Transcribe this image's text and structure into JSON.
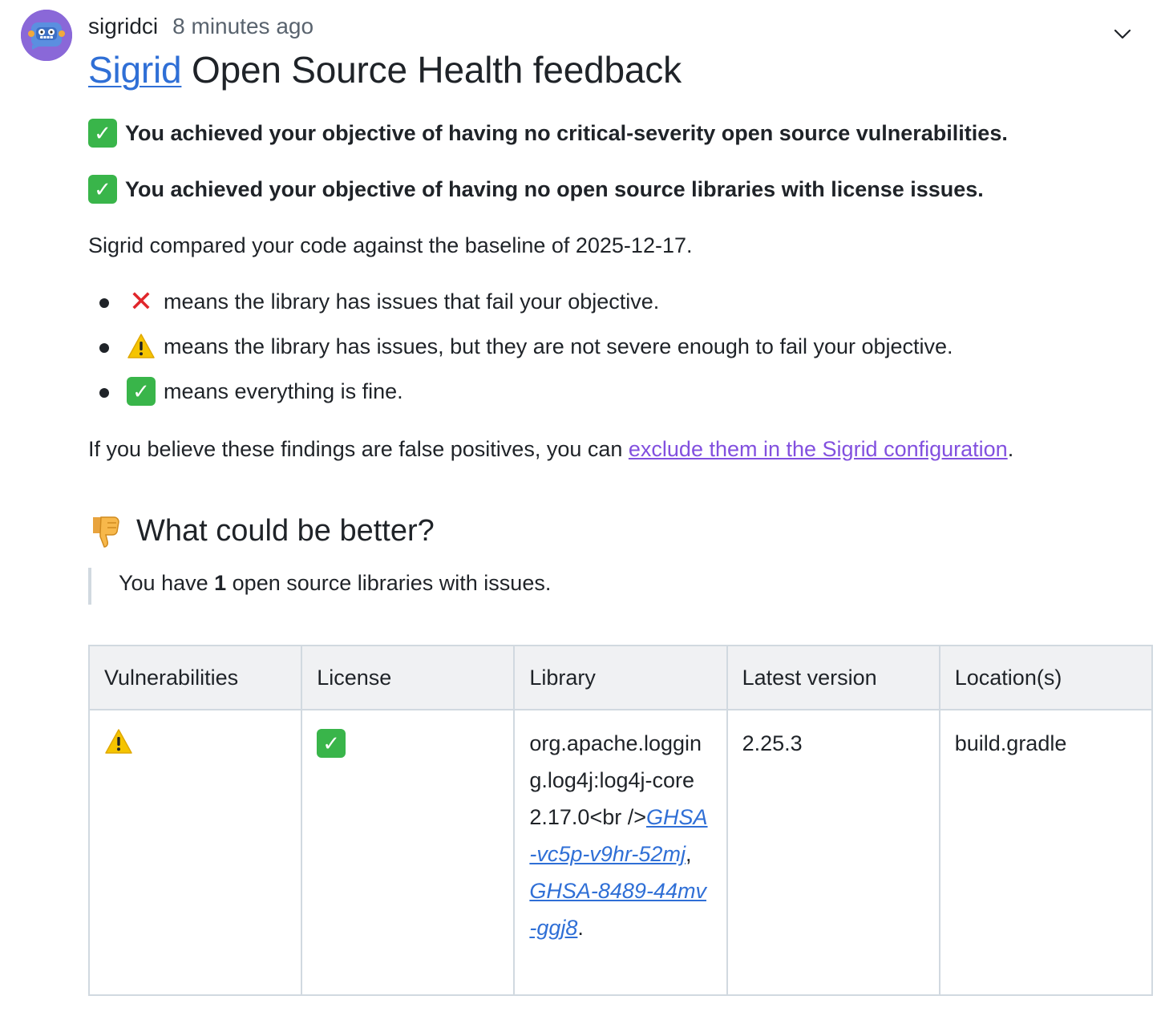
{
  "comment": {
    "author": "sigridci",
    "timestamp": "8 minutes ago",
    "icons": {
      "avatar": "robot-avatar-icon",
      "menu": "chevron-down-icon"
    }
  },
  "title": {
    "link_text": "Sigrid",
    "rest": " Open Source Health feedback"
  },
  "objectives": [
    {
      "icon": "check-mark-icon",
      "text": "You achieved your objective of having no critical-severity open source vulnerabilities."
    },
    {
      "icon": "check-mark-icon",
      "text": "You achieved your objective of having no open source libraries with license issues."
    }
  ],
  "baseline_text": "Sigrid compared your code against the baseline of 2025-12-17.",
  "legend": [
    {
      "icon": "cross-mark-icon",
      "text": "means the library has issues that fail your objective."
    },
    {
      "icon": "warning-icon",
      "text": "means the library has issues, but they are not severe enough to fail your objective."
    },
    {
      "icon": "check-mark-icon",
      "text": "means everything is fine."
    }
  ],
  "false_positive": {
    "before": "If you believe these findings are false positives, you can ",
    "link": "exclude them in the Sigrid configuration",
    "after": "."
  },
  "section_heading": {
    "icon": "thumbs-down-icon",
    "text": "What could be better?"
  },
  "summary": {
    "before": "You have ",
    "count": "1",
    "after": " open source libraries with issues."
  },
  "table": {
    "headers": [
      "Vulnerabilities",
      "License",
      "Library",
      "Latest version",
      "Location(s)"
    ],
    "rows": [
      {
        "vulnerabilities_icon": "warning-icon",
        "license_icon": "check-mark-icon",
        "library_text": "org.apache.logging.log4j:log4j-core 2.17.0<br />",
        "advisory_1": "GHSA-vc5p-v9hr-52mj",
        "separator": ", ",
        "advisory_2": "GHSA-8489-44mv-ggj8",
        "end": ".",
        "latest_version": "2.25.3",
        "location": "build.gradle"
      }
    ]
  },
  "colors": {
    "link": "#2f6fd6",
    "visited_link": "#8250df",
    "check_green": "#39b54a",
    "cross_red": "#e0262b",
    "warning_yellow": "#f5c400",
    "avatar_bg": "#8a68d8"
  }
}
